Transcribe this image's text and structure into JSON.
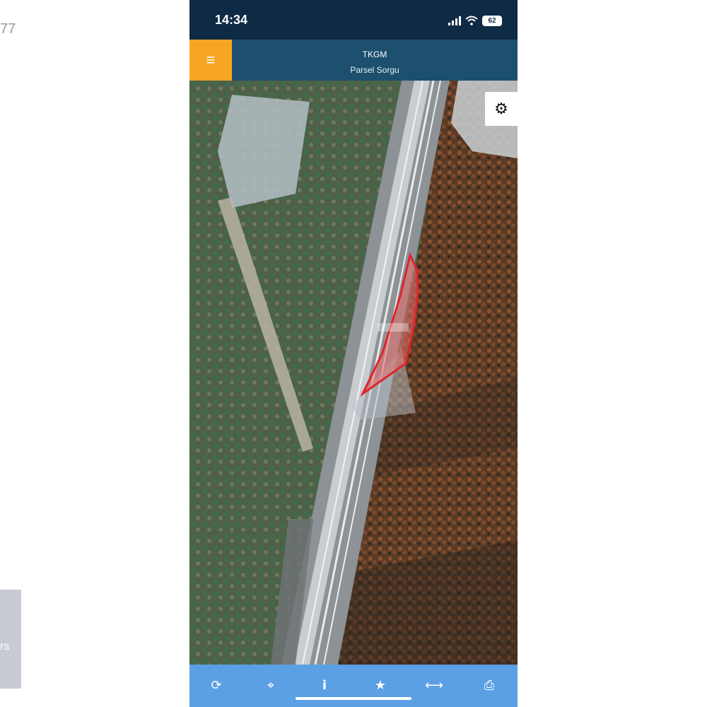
{
  "background_page": {
    "left_top_text": "77",
    "left_panel_text": "rs"
  },
  "status_bar": {
    "time": "14:34",
    "battery": "62"
  },
  "header": {
    "menu_icon": "hamburger-icon",
    "title": "TKGM",
    "subtitle": "Parsel Sorgu",
    "accent_color": "#f6a623",
    "bar_color": "#1d4f6e"
  },
  "map": {
    "type": "satellite",
    "parcel_label": "",
    "parcel_color": "#e0242b",
    "settings_icon": "gear-icon"
  },
  "toolbar": {
    "color": "#5b9fe4",
    "items": [
      {
        "icon": "refresh-icon",
        "glyph": "⟳"
      },
      {
        "icon": "locate-icon",
        "glyph": "⌖"
      },
      {
        "icon": "info-icon",
        "glyph": "i"
      },
      {
        "icon": "star-icon",
        "glyph": "★"
      },
      {
        "icon": "measure-icon",
        "glyph": "⟷"
      },
      {
        "icon": "print-icon",
        "glyph": "⎙"
      }
    ]
  }
}
